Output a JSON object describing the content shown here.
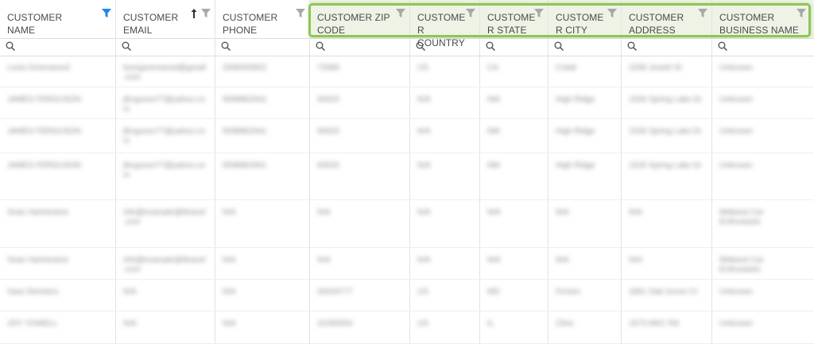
{
  "columns": [
    {
      "label": "CUSTOMER NAME",
      "filter_active": true,
      "sorted": false
    },
    {
      "label": "CUSTOMER EMAIL",
      "filter_active": false,
      "sorted": true
    },
    {
      "label": "CUSTOMER PHONE",
      "filter_active": false,
      "sorted": false
    },
    {
      "label": "CUSTOMER ZIP CODE",
      "filter_active": false,
      "sorted": false
    },
    {
      "label": "CUSTOMER COUNTRY",
      "filter_active": false,
      "sorted": false
    },
    {
      "label": "CUSTOMER STATE",
      "filter_active": false,
      "sorted": false
    },
    {
      "label": "CUSTOMER CITY",
      "filter_active": false,
      "sorted": false
    },
    {
      "label": "CUSTOMER ADDRESS",
      "filter_active": false,
      "sorted": false
    },
    {
      "label": "CUSTOMER BUSINESS NAME",
      "filter_active": false,
      "sorted": false
    }
  ],
  "sort_icon": "arrow-up-icon",
  "filter_icon": "funnel-icon",
  "search_icon": "magnifier-icon",
  "colors": {
    "highlight": "#8dc654",
    "filter_active": "#1e88e5",
    "filter_inactive": "#a8a8a8"
  },
  "rows": [
    [
      "Louis Greenwood",
      "louisgreenwood@gmail.com",
      "2608493922",
      "73389",
      "US",
      "CA",
      "Cotati",
      "2208 Jewett St",
      "Unknown"
    ],
    [
      "JAMES FERGUSON",
      "jferguson77@yahoo.com",
      "5598862941",
      "94520",
      "N/A",
      "NM",
      "High Ridge",
      "1526 Spring Lake Dr",
      "Unknown"
    ],
    [
      "JAMES FERGUSON",
      "jferguson77@yahoo.com",
      "5598862941",
      "94520",
      "N/A",
      "NM",
      "High Ridge",
      "1526 Spring Lake Dr",
      "Unknown"
    ],
    [
      "JAMES FERGUSON",
      "jferguson77@yahoo.com",
      "5598862941",
      "94520",
      "N/A",
      "NM",
      "High Ridge",
      "1526 Spring Lake Dr",
      "Unknown"
    ],
    [
      "Sean Hartneckee",
      "info@example@ittravel.com",
      "N/A",
      "N/A",
      "N/A",
      "N/A",
      "N/A",
      "N/A",
      "Midwest Car Enthusiasts"
    ],
    [
      "Sean Hartneckee",
      "info@example@ittravel.com",
      "N/A",
      "N/A",
      "N/A",
      "N/A",
      "N/A",
      "N/A",
      "Midwest Car Enthusiasts"
    ],
    [
      "Sara Streeters",
      "N/A",
      "N/A",
      "33426777",
      "US",
      "MD",
      "Fenton",
      "1861 Oak Grove Ct",
      "Unknown"
    ],
    [
      "JOY YOWELL",
      "N/A",
      "N/A",
      "22250554",
      "US",
      "IL",
      "Cline",
      "1573 MKC Rd",
      "Unknown"
    ]
  ]
}
